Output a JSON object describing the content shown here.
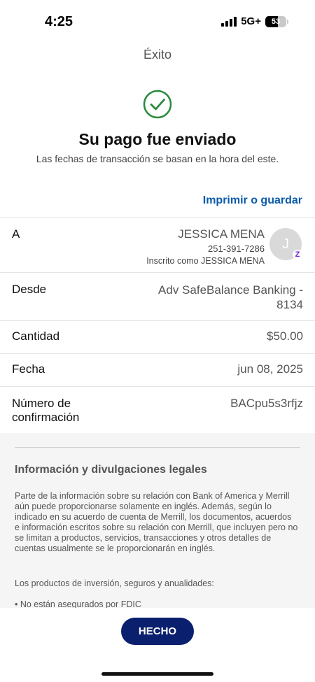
{
  "status_bar": {
    "time": "4:25",
    "network": "5G+",
    "battery": "53"
  },
  "header": {
    "title": "Éxito"
  },
  "success": {
    "icon": "check-circle-icon",
    "color": "#2a8a3e",
    "heading": "Su pago fue enviado",
    "subheading": "Las fechas de transacción se basan en la hora del este."
  },
  "actions": {
    "print_label": "Imprimir o guardar"
  },
  "details": {
    "to": {
      "label": "A",
      "name": "JESSICA MENA",
      "phone": "251-391-7286",
      "enrolled": "Inscrito como JESSICA MENA",
      "avatar_initial": "J",
      "badge": "Z"
    },
    "from": {
      "label": "Desde",
      "value_line1": "Adv SafeBalance Banking -",
      "value_line2": "8134"
    },
    "amount": {
      "label": "Cantidad",
      "value": "$50.00"
    },
    "date": {
      "label": "Fecha",
      "value": "jun 08, 2025"
    },
    "confirmation": {
      "label_line1": "Número de",
      "label_line2": "confirmación",
      "value": "BACpu5s3rfjz"
    }
  },
  "legal": {
    "title": "Información y divulgaciones legales",
    "paragraph1": "Parte de la información sobre su relación con Bank of America y Merrill aún puede proporcionarse solamente en inglés. Además, según lo indicado en su acuerdo de cuenta de Merrill, los documentos, acuerdos e información escritos sobre su relación con Merrill, que incluyen pero no se limitan a productos, servicios, transacciones y otros detalles de cuentas usualmente se le proporcionarán en inglés.",
    "paragraph2": "Los productos de inversión, seguros y anualidades:",
    "bullet1": "• No están asegurados por FDIC"
  },
  "footer": {
    "done_label": "HECHO",
    "button_color": "#0a1f6e"
  },
  "colors": {
    "link": "#0a5aa8",
    "zelle": "#6d1ed4"
  }
}
